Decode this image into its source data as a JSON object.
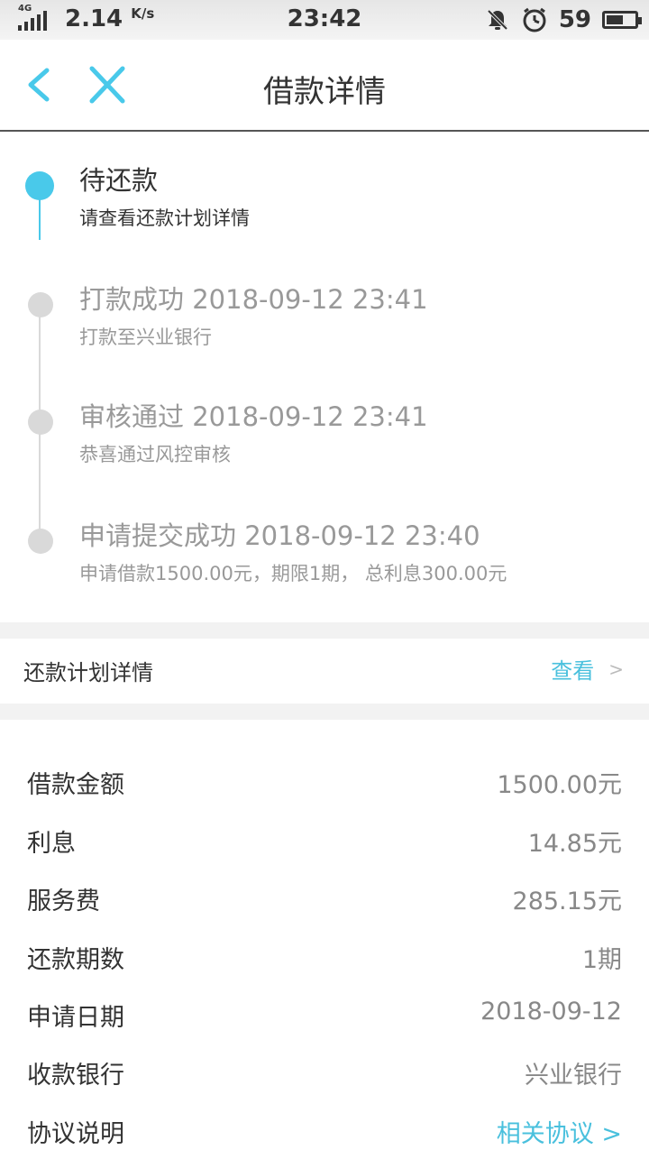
{
  "status_bar": {
    "network_tag": "4G",
    "speed": "2.14",
    "speed_unit": "K/s",
    "time": "23:42",
    "battery_level": "59",
    "battery_fraction": 0.59
  },
  "header": {
    "title": "借款详情",
    "back_icon": "chevron-left-icon",
    "close_icon": "close-icon"
  },
  "timeline": {
    "steps": [
      {
        "title": "待还款",
        "desc": "请查看还款计划详情",
        "active": true
      },
      {
        "title": "打款成功 2018-09-12 23:41",
        "desc": "打款至兴业银行",
        "active": false
      },
      {
        "title": "审核通过 2018-09-12 23:41",
        "desc": "恭喜通过风控审核",
        "active": false
      },
      {
        "title": "申请提交成功 2018-09-12 23:40",
        "desc": "申请借款1500.00元，期限1期， 总利息300.00元",
        "active": false
      }
    ]
  },
  "repayment_plan": {
    "label": "还款计划详情",
    "action": "查看",
    "chevron": ">"
  },
  "details": {
    "rows": [
      {
        "label": "借款金额",
        "value": "1500.00元"
      },
      {
        "label": "利息",
        "value": "14.85元"
      },
      {
        "label": "服务费",
        "value": "285.15元"
      },
      {
        "label": "还款期数",
        "value": "1期"
      },
      {
        "label": "申请日期",
        "value": "2018-09-12"
      },
      {
        "label": "收款银行",
        "value": "兴业银行"
      },
      {
        "label": "协议说明",
        "value": "相关协议 >"
      }
    ]
  },
  "colors": {
    "accent": "#49c9ea",
    "link": "#49c0dd",
    "inactive_dot": "#d9d9d9",
    "inactive_text": "#999999",
    "section_gap": "#f2f2f2"
  }
}
